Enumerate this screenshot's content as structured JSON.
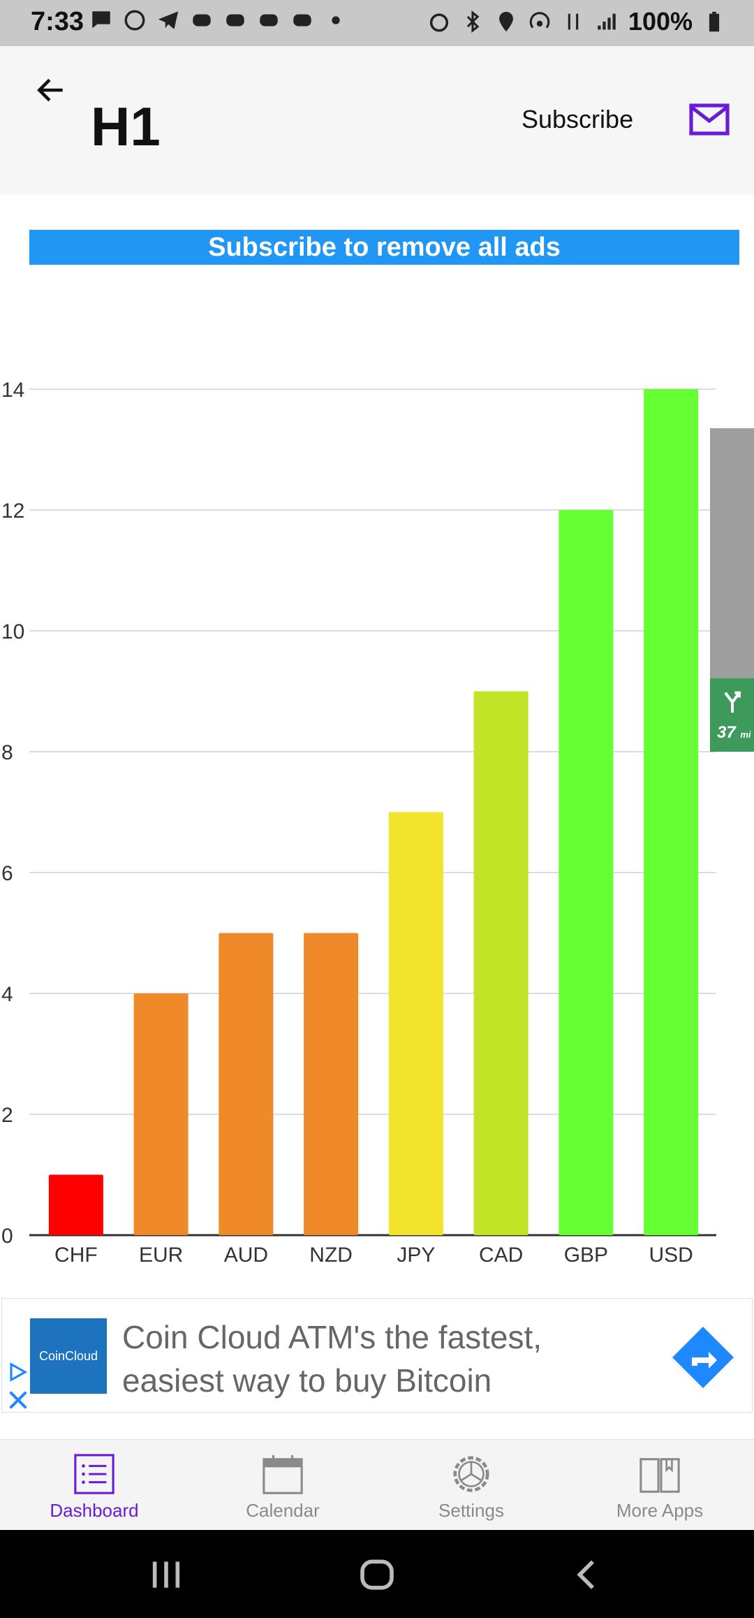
{
  "status_bar": {
    "time": "7:33",
    "battery": "100%",
    "left_icons": [
      "message-icon",
      "whatsapp-icon",
      "telegram-icon",
      "discord-icon",
      "discord-icon",
      "discord-icon",
      "discord-icon",
      "dot-icon"
    ],
    "right_icons": [
      "alarm-icon",
      "bluetooth-icon",
      "location-icon",
      "hotspot-icon",
      "data-icon",
      "signal-icon",
      "battery-icon"
    ]
  },
  "header": {
    "title": "H1",
    "subscribe_label": "Subscribe",
    "accent_color": "#6a1bd6"
  },
  "banner": {
    "text": "Subscribe to remove all ads",
    "color": "#2196f3"
  },
  "chart_data": {
    "type": "bar",
    "categories": [
      "CHF",
      "EUR",
      "AUD",
      "NZD",
      "JPY",
      "CAD",
      "GBP",
      "USD"
    ],
    "values": [
      1,
      4,
      5,
      5,
      7,
      9,
      12,
      14
    ],
    "colors": [
      "#ff0000",
      "#f0892a",
      "#f0892a",
      "#f0892a",
      "#f2e42c",
      "#c2e427",
      "#66ff33",
      "#66ff33"
    ],
    "ylim": [
      0,
      14
    ],
    "yticks": [
      0,
      2,
      4,
      6,
      8,
      10,
      12,
      14
    ],
    "grid": true,
    "title": "",
    "xlabel": "",
    "ylabel": ""
  },
  "side_widget": {
    "distance": "37",
    "unit": "mi"
  },
  "ad": {
    "brand": "CoinCloud",
    "text": "Coin Cloud ATM's the fastest, easiest way to buy Bitcoin"
  },
  "bottom_nav": {
    "items": [
      {
        "label": "Dashboard",
        "icon": "list-icon",
        "active": true
      },
      {
        "label": "Calendar",
        "icon": "calendar-icon",
        "active": false
      },
      {
        "label": "Settings",
        "icon": "gear-icon",
        "active": false
      },
      {
        "label": "More Apps",
        "icon": "book-icon",
        "active": false
      }
    ]
  }
}
